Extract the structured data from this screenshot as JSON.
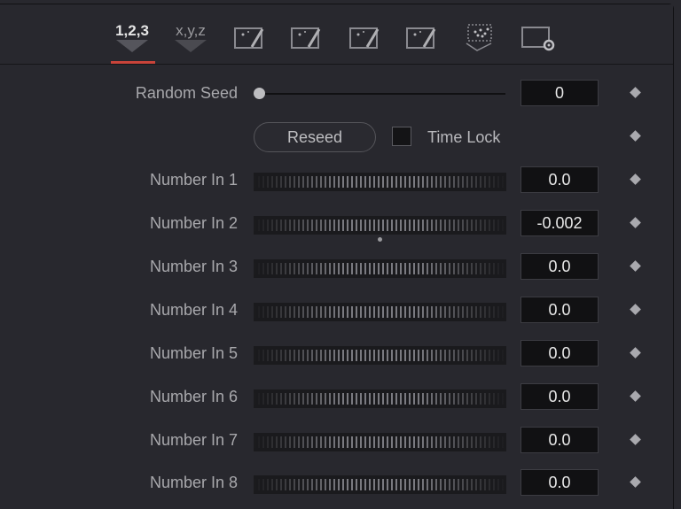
{
  "tabs": [
    {
      "label": "1,2,3",
      "active": true,
      "icon": null
    },
    {
      "label": "x,y,z",
      "active": false,
      "icon": null
    },
    {
      "label": "",
      "active": false,
      "icon": "image-wand-icon"
    },
    {
      "label": "",
      "active": false,
      "icon": "image-wand-icon"
    },
    {
      "label": "",
      "active": false,
      "icon": "image-wand-icon"
    },
    {
      "label": "",
      "active": false,
      "icon": "image-wand-icon"
    },
    {
      "label": "",
      "active": false,
      "icon": "particles-icon"
    },
    {
      "label": "",
      "active": false,
      "icon": "settings-icon"
    }
  ],
  "random_seed": {
    "label": "Random Seed",
    "value": "0",
    "slider_fraction": 0
  },
  "reseed_button": "Reseed",
  "time_lock": {
    "label": "Time Lock",
    "checked": false
  },
  "numbers": [
    {
      "label": "Number In 1",
      "value": "0.0"
    },
    {
      "label": "Number In 2",
      "value": "-0.002"
    },
    {
      "label": "Number In 3",
      "value": "0.0"
    },
    {
      "label": "Number In 4",
      "value": "0.0"
    },
    {
      "label": "Number In 5",
      "value": "0.0"
    },
    {
      "label": "Number In 6",
      "value": "0.0"
    },
    {
      "label": "Number In 7",
      "value": "0.0"
    },
    {
      "label": "Number In 8",
      "value": "0.0"
    }
  ],
  "colors": {
    "accent": "#c9443a",
    "background": "#28282e",
    "field": "#111113"
  }
}
